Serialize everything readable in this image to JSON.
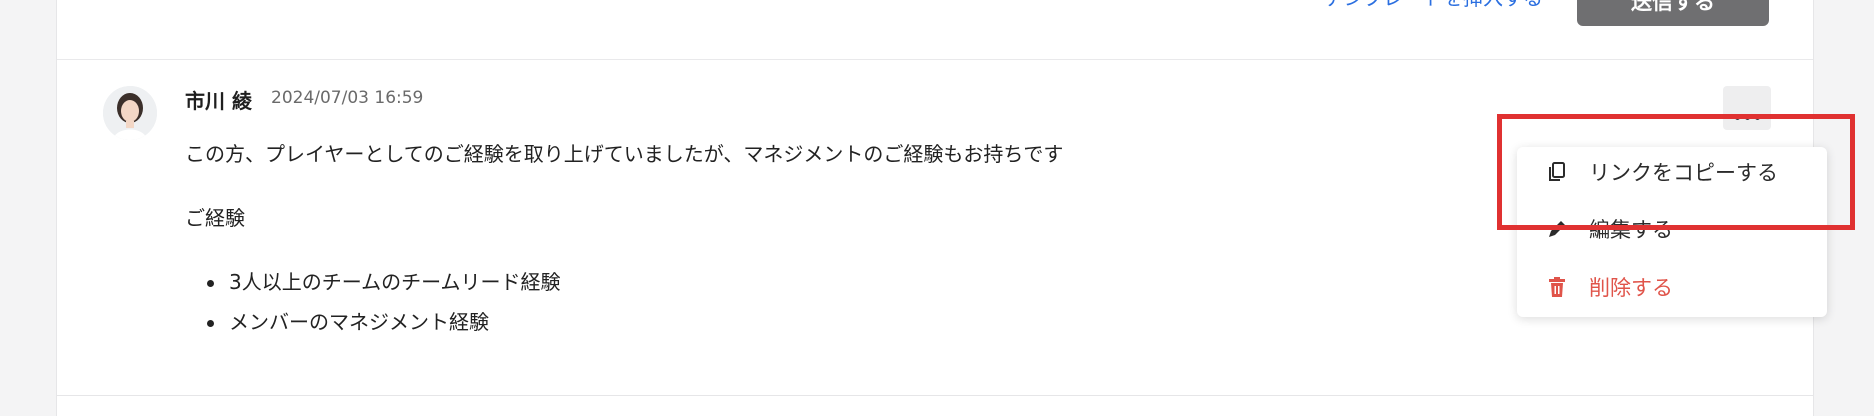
{
  "header": {
    "template_link": "テンプレートを挿入する",
    "send_button": "送信する"
  },
  "comment": {
    "author": "市川 綾",
    "timestamp": "2024/07/03 16:59",
    "paragraph1": "この方、プレイヤーとしてのご経験を取り上げていましたが、マネジメントのご経験もお持ちです",
    "paragraph2": "ご経験",
    "bullets": [
      "3人以上のチームのチームリード経験",
      "メンバーのマネジメント経験"
    ]
  },
  "menu": {
    "items": [
      {
        "label": "リンクをコピーする",
        "icon": "copy-icon"
      },
      {
        "label": "編集する",
        "icon": "pencil-icon"
      },
      {
        "label": "削除する",
        "icon": "trash-icon",
        "color": "#e0544a"
      }
    ]
  },
  "colors": {
    "accent": "#2b6fe0",
    "danger": "#e0544a",
    "highlight": "#e03131"
  }
}
